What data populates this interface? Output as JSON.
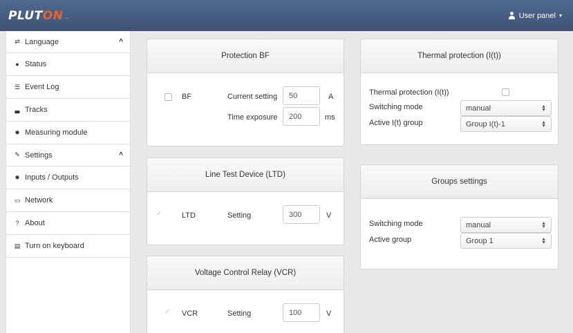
{
  "header": {
    "logo_main": "PLUT",
    "logo_accent": "ON",
    "logo_tag": "—",
    "user_panel": "User panel",
    "caret": "▾"
  },
  "sidebar": {
    "items": [
      {
        "label": "Language",
        "icon": "language-icon",
        "glyph": "⇄",
        "section": true,
        "chevron": "^"
      },
      {
        "label": "Status",
        "icon": "speech-bubble-icon",
        "glyph": "●"
      },
      {
        "label": "Event Log",
        "icon": "list-icon",
        "glyph": "☰"
      },
      {
        "label": "Tracks",
        "icon": "chart-icon",
        "glyph": "▃"
      },
      {
        "label": "Measuring module",
        "icon": "gear-icon",
        "glyph": "✹"
      },
      {
        "label": "Settings",
        "icon": "wrench-icon",
        "glyph": "✎",
        "section": true,
        "chevron": "^"
      },
      {
        "label": "Inputs / Outputs",
        "icon": "gear-icon",
        "glyph": "✹"
      },
      {
        "label": "Network",
        "icon": "laptop-icon",
        "glyph": "▭"
      },
      {
        "label": "About",
        "icon": "question-icon",
        "glyph": "?"
      },
      {
        "label": "Turn on keyboard",
        "icon": "keyboard-icon",
        "glyph": "▤"
      }
    ]
  },
  "protection_bf": {
    "title": "Protection BF",
    "checkbox_label": "BF",
    "current_label": "Current setting",
    "current_value": "50",
    "current_unit": "A",
    "time_label": "Time exposure",
    "time_value": "200",
    "time_unit": "ms",
    "checked": false
  },
  "ltd": {
    "title": "Line Test Device (LTD)",
    "checkbox_label": "LTD",
    "setting_label": "Setting",
    "setting_value": "300",
    "unit": "V",
    "checked": true
  },
  "vcr": {
    "title": "Voltage Control Relay (VCR)",
    "checkbox_label": "VCR",
    "setting_label": "Setting",
    "setting_value": "100",
    "unit": "V",
    "checked": true
  },
  "thermal": {
    "title": "Thermal protection (I(t))",
    "enable_label": "Thermal protection (I(t))",
    "enabled": false,
    "switching_label": "Switching mode",
    "switching_value": "manual",
    "group_label": "Active I(t) group",
    "group_value": "Group I(t)-1"
  },
  "groups": {
    "title": "Groups settings",
    "switching_label": "Switching mode",
    "switching_value": "manual",
    "group_label": "Active group",
    "group_value": "Group 1"
  }
}
